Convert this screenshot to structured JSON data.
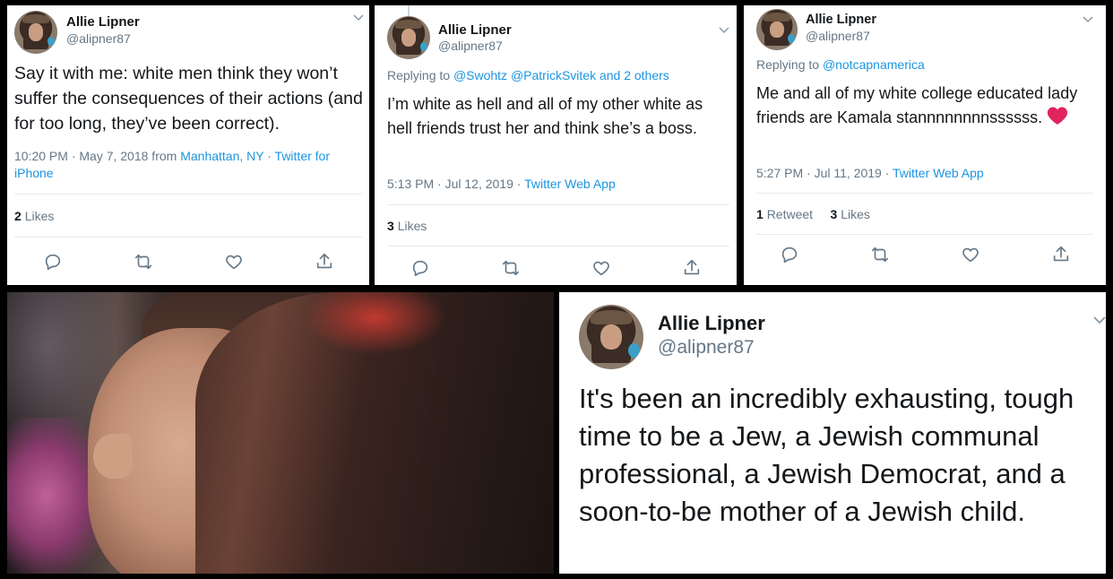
{
  "tweet1": {
    "name": "Allie Lipner",
    "handle": "@alipner87",
    "text": "Say it with me: white men think they won’t suffer the consequences of their actions (and for too long, they’ve been correct).",
    "time": "10:20 PM · May 7, 2018 from ",
    "location": "Manhattan, NY",
    "sep": " · ",
    "source_a": "Twitter for",
    "source_b": "iPhone",
    "likes_count": "2",
    "likes_label": "Likes"
  },
  "tweet2": {
    "name": "Allie Lipner",
    "handle": "@alipner87",
    "reply_prefix": "Replying to ",
    "reply_targets": "@Swohtz @PatrickSvitek and 2 others",
    "text": "I’m white as hell and all of my other white as hell friends trust her and think she’s a boss.",
    "time": "5:13 PM · Jul 12, 2019 · ",
    "source": "Twitter Web App",
    "likes_count": "3",
    "likes_label": "Likes"
  },
  "tweet3": {
    "name": "Allie Lipner",
    "handle": "@alipner87",
    "reply_prefix": "Replying to ",
    "reply_targets": "@notcapnamerica",
    "text": "Me and all of my white college educated lady friends are Kamala stannnnnnnnssssss.",
    "emoji": "❤️",
    "time": "5:27 PM · Jul 11, 2019 · ",
    "source": "Twitter Web App",
    "retweets_count": "1",
    "retweets_label": "Retweet",
    "likes_count": "3",
    "likes_label": "Likes"
  },
  "tweet4": {
    "name": "Allie Lipner",
    "handle": "@alipner87",
    "text": "It's been an incredibly exhausting, tough time to be a Jew, a Jewish communal professional, a Jewish Democrat, and a soon-to-be mother of a Jewish child."
  },
  "icons": {
    "reply": "reply-icon",
    "retweet": "retweet-icon",
    "like": "heart-icon",
    "share": "share-icon",
    "menu": "chevron-down-icon"
  },
  "colors": {
    "link": "#1b95e0",
    "secondary": "#657786",
    "primary": "#14171a",
    "divider": "#e6ecf0"
  }
}
